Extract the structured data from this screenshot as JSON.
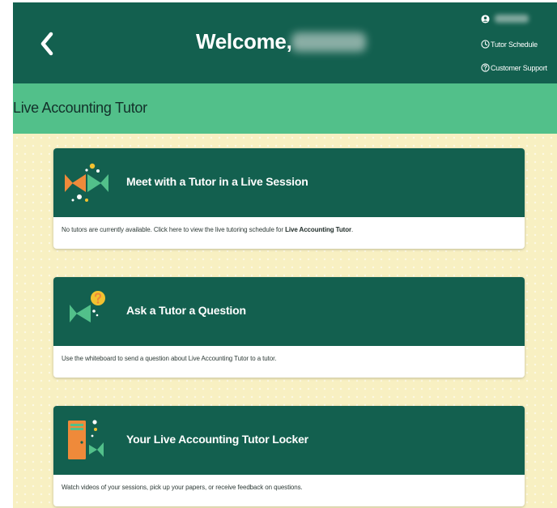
{
  "header": {
    "welcome": "Welcome,",
    "links": {
      "tutor_schedule": "Tutor Schedule",
      "customer_support": "Customer Support"
    }
  },
  "section": {
    "title": "Live Accounting Tutor"
  },
  "cards": [
    {
      "title": "Meet with a Tutor in a Live Session",
      "desc": "No tutors are currently available. Click here to view the live tutoring schedule for ",
      "desc_bold": "Live Accounting Tutor",
      "desc_end": "."
    },
    {
      "title": "Ask a Tutor a Question",
      "desc": "Use the whiteboard to send a question about Live Accounting Tutor to a tutor."
    },
    {
      "title": "Your Live Accounting Tutor Locker",
      "desc": "Watch videos of your sessions, pick up your papers, or receive feedback on questions."
    }
  ],
  "colors": {
    "header_green": "#13604f",
    "section_green": "#52c08a",
    "content_bg": "#f8f0c2",
    "accent_orange": "#ef8a3a",
    "accent_mint": "#52c08a",
    "accent_yellow": "#f2c230"
  },
  "icons": {
    "back": "chevron-left-icon",
    "user": "user-icon",
    "schedule": "clock-icon",
    "support": "question-circle-icon",
    "live_session": "fish-meeting-icon",
    "question": "fish-question-icon",
    "locker": "locker-icon"
  }
}
